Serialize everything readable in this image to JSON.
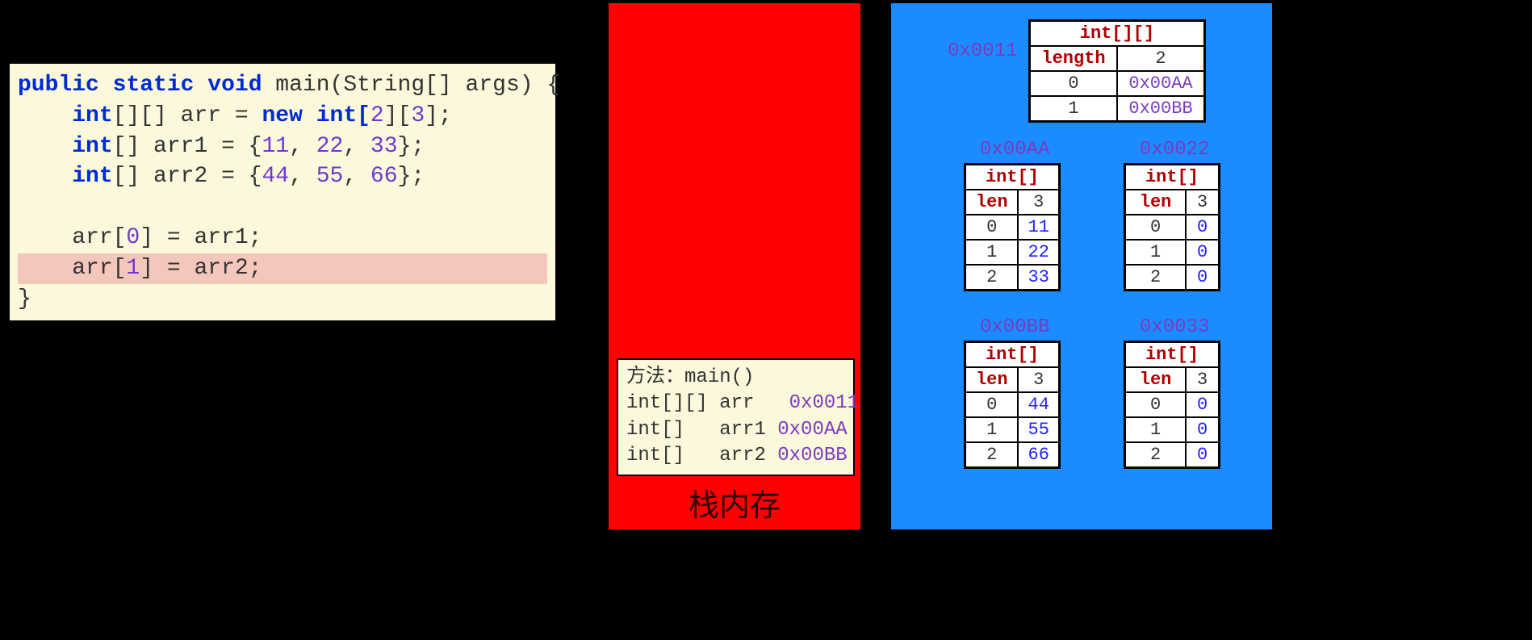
{
  "code": {
    "l1_kw1": "public",
    "l1_kw2": "static",
    "l1_kw3": "void",
    "l1_rest": " main(String[] args) {",
    "l2_kw": "int",
    "l2_a": "[][] arr = ",
    "l2_kw2": "new",
    "l2_b": " int[",
    "l2_n1": "2",
    "l2_c": "][",
    "l2_n2": "3",
    "l2_d": "];",
    "l3_kw": "int",
    "l3_a": "[] arr1 = {",
    "l3_n1": "11",
    "l3_s1": ", ",
    "l3_n2": "22",
    "l3_s2": ", ",
    "l3_n3": "33",
    "l3_b": "};",
    "l4_kw": "int",
    "l4_a": "[] arr2 = {",
    "l4_n1": "44",
    "l4_s1": ", ",
    "l4_n2": "55",
    "l4_s2": ", ",
    "l4_n3": "66",
    "l4_b": "};",
    "l6_a": "    arr[",
    "l6_n": "0",
    "l6_b": "] = arr1;",
    "l7_a": "    arr[",
    "l7_n": "1",
    "l7_b": "] = arr2;",
    "l8": "}"
  },
  "stack": {
    "label": "栈内存",
    "frame": {
      "method_lbl": "方法：",
      "method": "main()",
      "rows": [
        {
          "type": "int[][]",
          "name": "arr ",
          "addr": "0x0011"
        },
        {
          "type": "int[]  ",
          "name": "arr1",
          "addr": "0x00AA"
        },
        {
          "type": "int[]  ",
          "name": "arr2",
          "addr": "0x00BB"
        }
      ]
    }
  },
  "heap": {
    "addr_2d": "0x0011",
    "t2d": {
      "title": "int[][]",
      "len_lbl": "length",
      "len": "2",
      "rows": [
        {
          "idx": "0",
          "val": "0x00AA"
        },
        {
          "idx": "1",
          "val": "0x00BB"
        }
      ]
    },
    "tables": {
      "a1": {
        "addr": "0x00AA",
        "title": "int[]",
        "len_lbl": "len",
        "len": "3",
        "rows": [
          {
            "idx": "0",
            "val": "11"
          },
          {
            "idx": "1",
            "val": "22"
          },
          {
            "idx": "2",
            "val": "33"
          }
        ]
      },
      "a2": {
        "addr": "0x0022",
        "title": "int[]",
        "len_lbl": "len",
        "len": "3",
        "rows": [
          {
            "idx": "0",
            "val": "0"
          },
          {
            "idx": "1",
            "val": "0"
          },
          {
            "idx": "2",
            "val": "0"
          }
        ]
      },
      "b1": {
        "addr": "0x00BB",
        "title": "int[]",
        "len_lbl": "len",
        "len": "3",
        "rows": [
          {
            "idx": "0",
            "val": "44"
          },
          {
            "idx": "1",
            "val": "55"
          },
          {
            "idx": "2",
            "val": "66"
          }
        ]
      },
      "b2": {
        "addr": "0x0033",
        "title": "int[]",
        "len_lbl": "len",
        "len": "3",
        "rows": [
          {
            "idx": "0",
            "val": "0"
          },
          {
            "idx": "1",
            "val": "0"
          },
          {
            "idx": "2",
            "val": "0"
          }
        ]
      }
    }
  }
}
